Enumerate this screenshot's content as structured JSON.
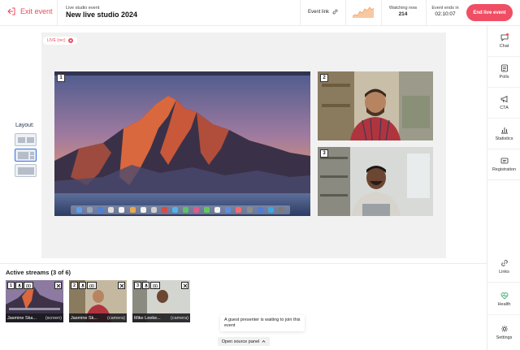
{
  "header": {
    "exit_label": "Exit event",
    "event_kicker": "Live studio event",
    "event_title": "New live studio 2024",
    "event_link_label": "Event link",
    "watching_label": "Watching now",
    "watching_count": "214",
    "ends_label": "Event ends in",
    "ends_time": "02:10:07",
    "end_button": "End live event"
  },
  "stage": {
    "live_badge": "LIVE (rec)",
    "tiles": [
      {
        "number": "1",
        "icon": "desktop-screen-share"
      },
      {
        "number": "2",
        "icon": "webcam-person"
      },
      {
        "number": "3",
        "icon": "webcam-person"
      }
    ]
  },
  "layout": {
    "label": "Layout:",
    "options": [
      "layout-split",
      "layout-main-side",
      "layout-single"
    ],
    "active_index": 1
  },
  "sidebar": {
    "items": [
      {
        "label": "Chat",
        "icon": "chat-icon"
      },
      {
        "label": "Polls",
        "icon": "polls-icon"
      },
      {
        "label": "CTA",
        "icon": "megaphone-icon"
      },
      {
        "label": "Statistics",
        "icon": "bar-chart-icon"
      },
      {
        "label": "Registration",
        "icon": "id-card-icon"
      },
      {
        "label": "Links",
        "icon": "link-icon"
      },
      {
        "label": "Health",
        "icon": "heart-pulse-icon"
      },
      {
        "label": "Settings",
        "icon": "gear-icon"
      }
    ]
  },
  "streams": {
    "title": "Active streams (3 of 6)",
    "items": [
      {
        "number": "1",
        "name": "Jasmine Ska...",
        "type": "(screen)"
      },
      {
        "number": "2",
        "name": "Jasmine Sk...",
        "type": "(camera)"
      },
      {
        "number": "3",
        "name": "Mike Leeke...",
        "type": "(camera)"
      }
    ]
  },
  "guest_notice": "A guest presenter is waiting to join this event",
  "source_panel_label": "Open source panel",
  "colors": {
    "accent": "#ef4e64",
    "stage_bg": "#f1f1f1",
    "layout_active": "#3c6fd9"
  }
}
